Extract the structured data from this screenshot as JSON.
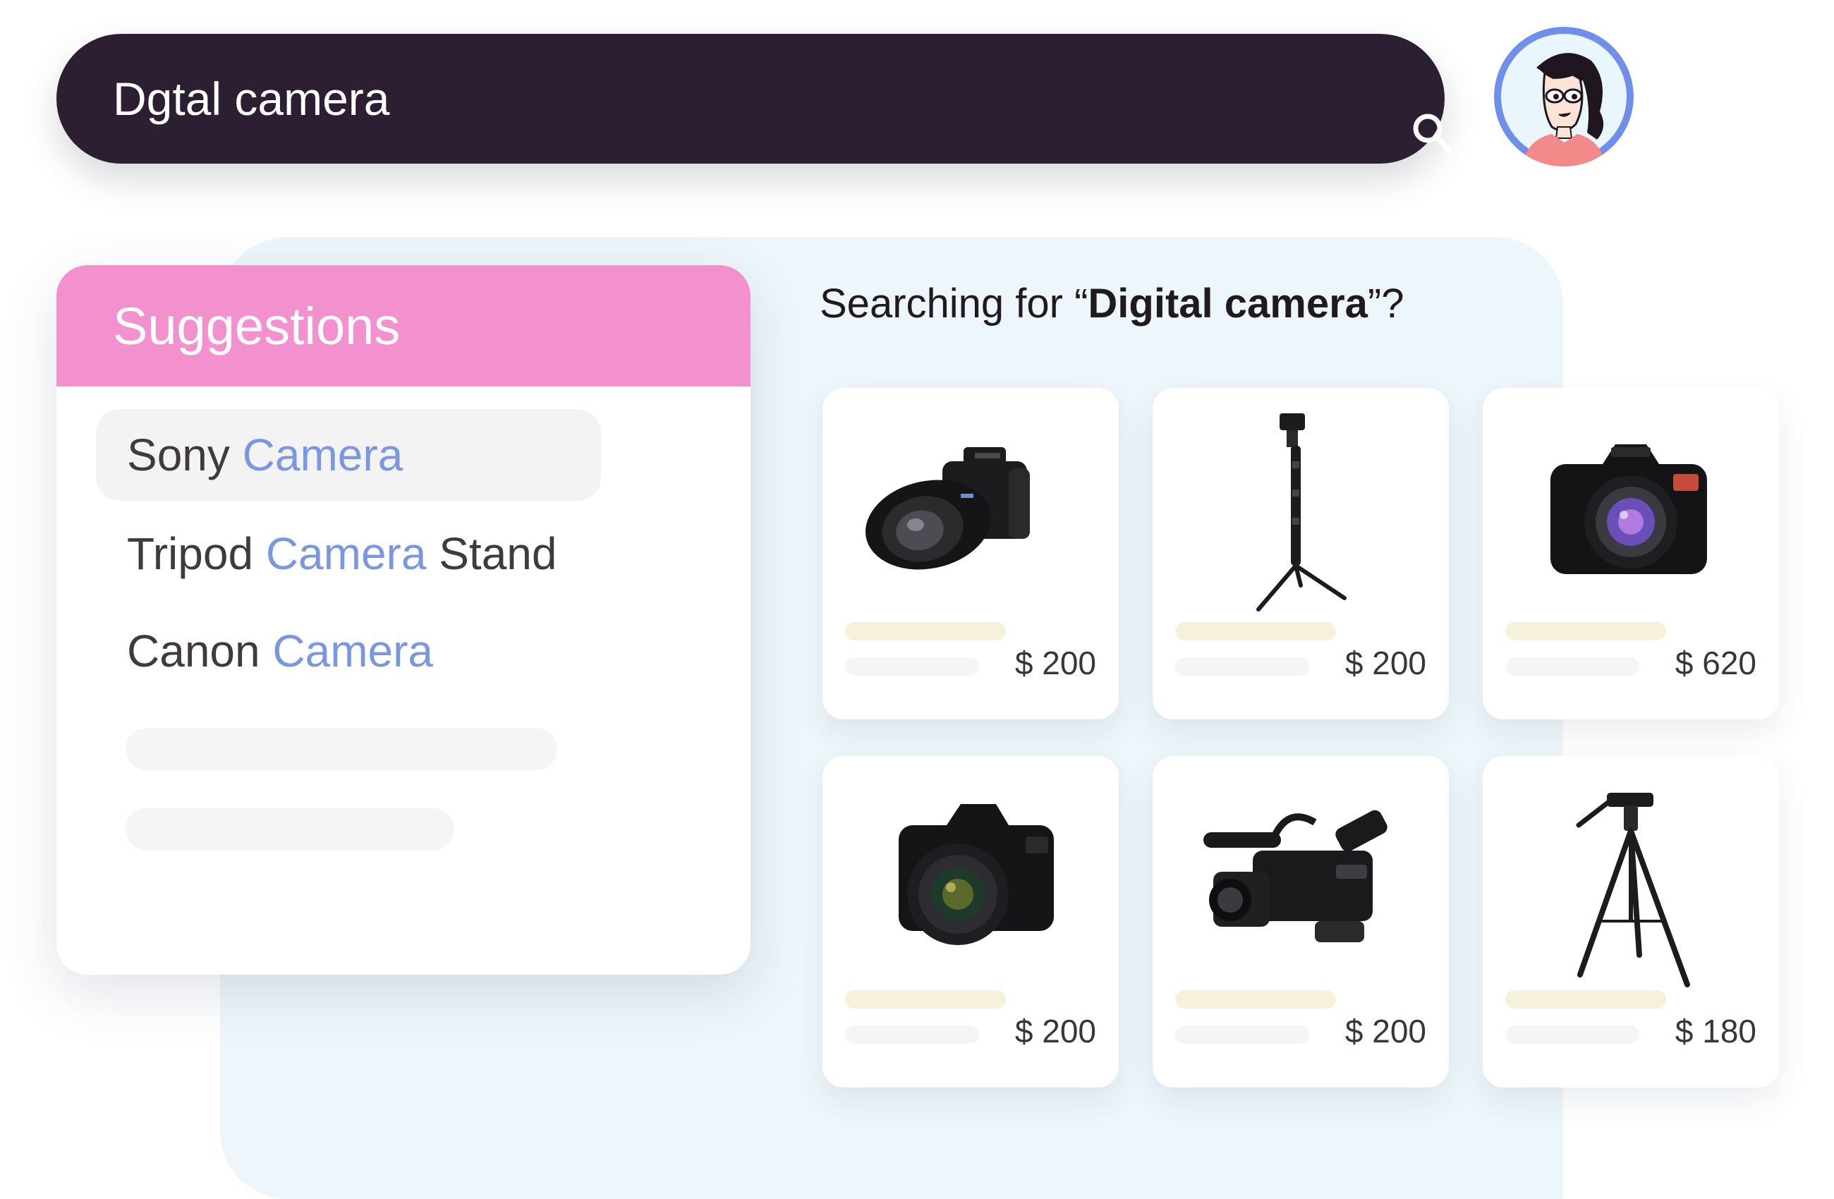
{
  "search": {
    "value": "Dgtal camera",
    "icon": "search-icon"
  },
  "avatar": {
    "icon": "user-avatar"
  },
  "suggestions": {
    "title": "Suggestions",
    "items": [
      {
        "prefix": "Sony ",
        "highlight": "Camera",
        "suffix": ""
      },
      {
        "prefix": "Tripod ",
        "highlight": "Camera",
        "suffix": " Stand"
      },
      {
        "prefix": "Canon ",
        "highlight": "Camera",
        "suffix": ""
      }
    ]
  },
  "query": {
    "prefix": "Searching for “",
    "term": "Digital camera",
    "suffix": "”?"
  },
  "products": [
    {
      "image": "mirrorless-camera-icon",
      "price": "$ 200"
    },
    {
      "image": "gimbal-stick-icon",
      "price": "$ 200"
    },
    {
      "image": "dslr-camera-icon",
      "price": "$ 620"
    },
    {
      "image": "canon-dslr-icon",
      "price": "$ 200"
    },
    {
      "image": "camcorder-icon",
      "price": "$ 200"
    },
    {
      "image": "tripod-icon",
      "price": "$ 180"
    }
  ],
  "colors": {
    "search_bar": "#2b1f31",
    "suggestions_header": "#f391cf",
    "highlight": "#7c97e2",
    "panel_bg": "#edf6fa",
    "title_placeholder": "#f6f2d9"
  }
}
